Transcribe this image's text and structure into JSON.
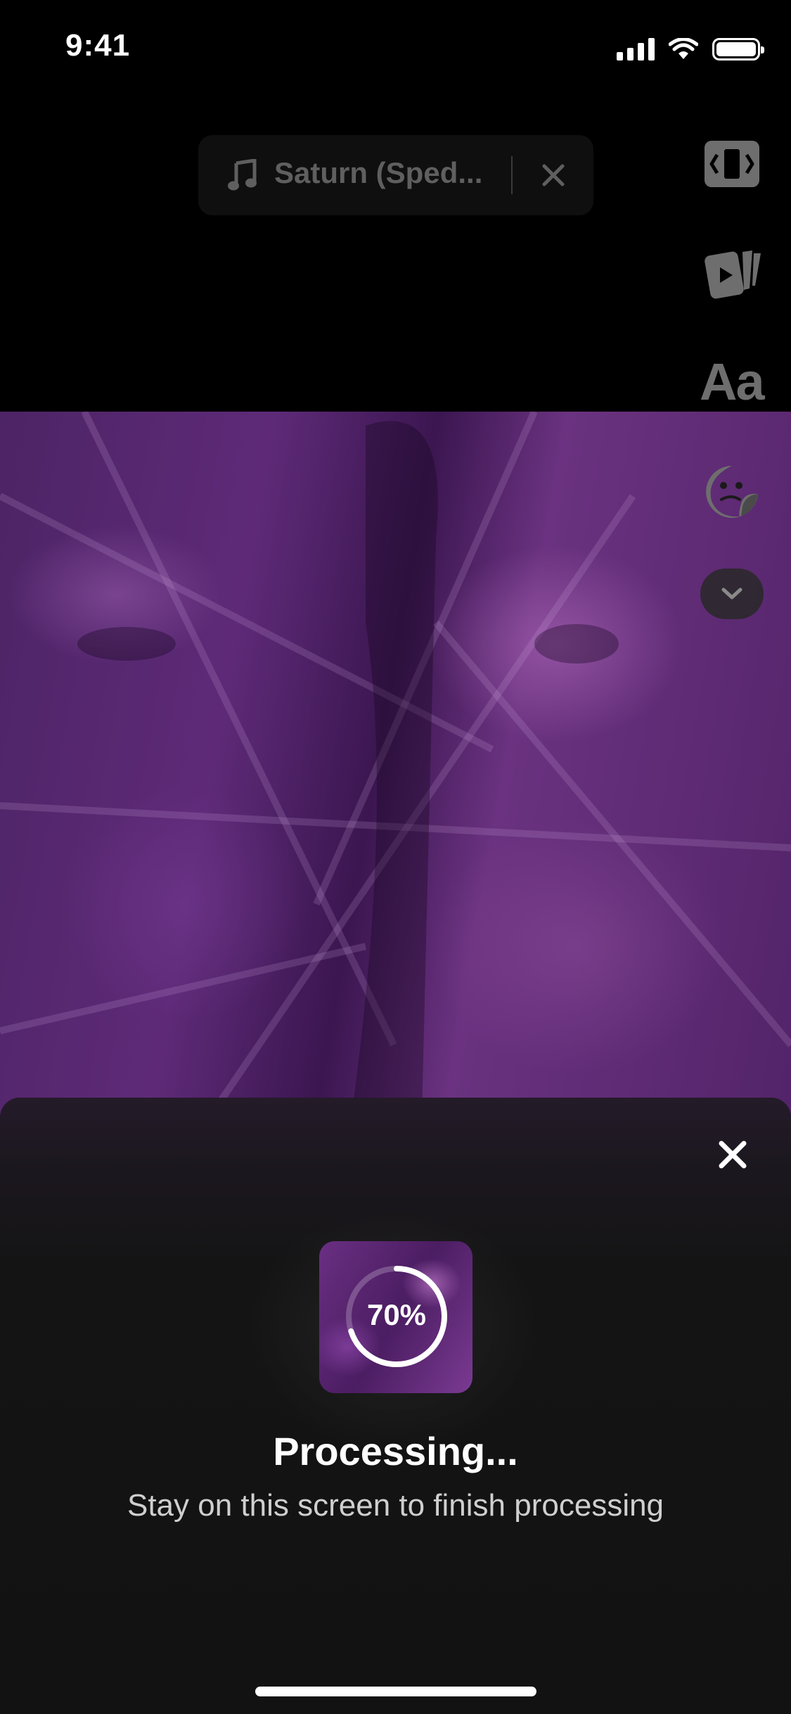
{
  "status_bar": {
    "time": "9:41"
  },
  "music": {
    "title": "Saturn (Sped..."
  },
  "tools": {
    "text_label": "Aa"
  },
  "processing": {
    "progress_label": "70%",
    "progress_fraction": 0.7,
    "title": "Processing...",
    "subtitle": "Stay on this screen to finish processing"
  },
  "colors": {
    "accent_purple": "#5e2a78",
    "sheet_background": "#121212",
    "muted_icon": "#6e6e6e"
  },
  "icons": [
    "music-note-icon",
    "close-icon",
    "reframe-icon",
    "clips-icon",
    "sticker-icon",
    "chevron-down-icon"
  ]
}
